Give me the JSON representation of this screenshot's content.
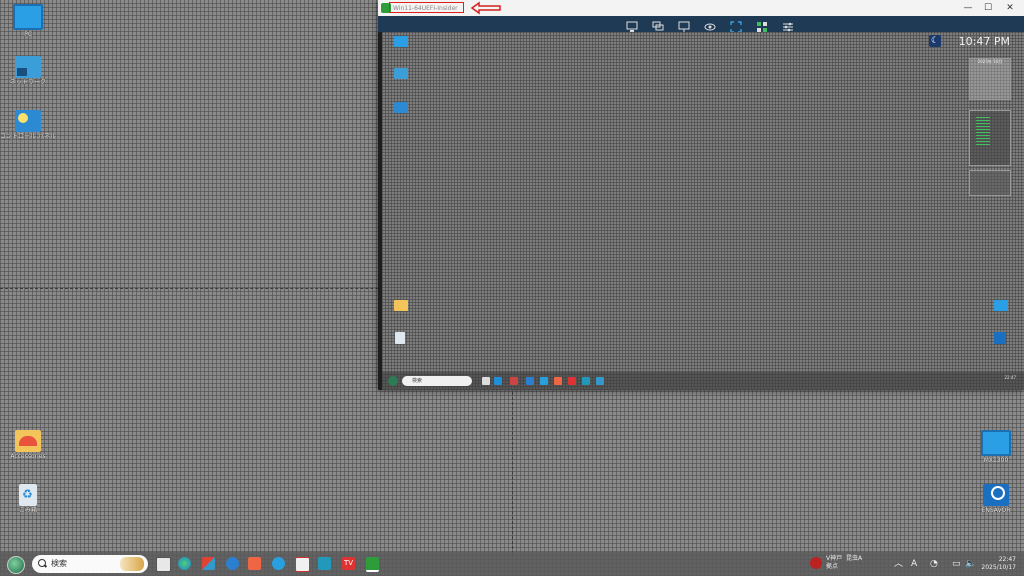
{
  "desktop": {
    "icons": [
      {
        "label": "PC"
      },
      {
        "label": "ネットワーク"
      },
      {
        "label": "コントロール パネル"
      },
      {
        "label": "Accessories"
      },
      {
        "label": "ごみ箱"
      },
      {
        "label": "MX1300"
      },
      {
        "label": "ENSAVOR"
      }
    ]
  },
  "vm_window": {
    "title": "Win11-64UEFI-Insider",
    "minimize": "—",
    "maximize": "☐",
    "close": "✕",
    "guest": {
      "clock": "10:47 PM",
      "search_placeholder": "検索",
      "calendar_title": "2025年 10月"
    }
  },
  "taskbar": {
    "search_placeholder": "検索",
    "ime_line1": "V神戸",
    "ime_line2": "拠点",
    "ime_line3": "昆虫A",
    "time": "22:47",
    "date": "2025/10/17",
    "input_indicator": "A"
  }
}
